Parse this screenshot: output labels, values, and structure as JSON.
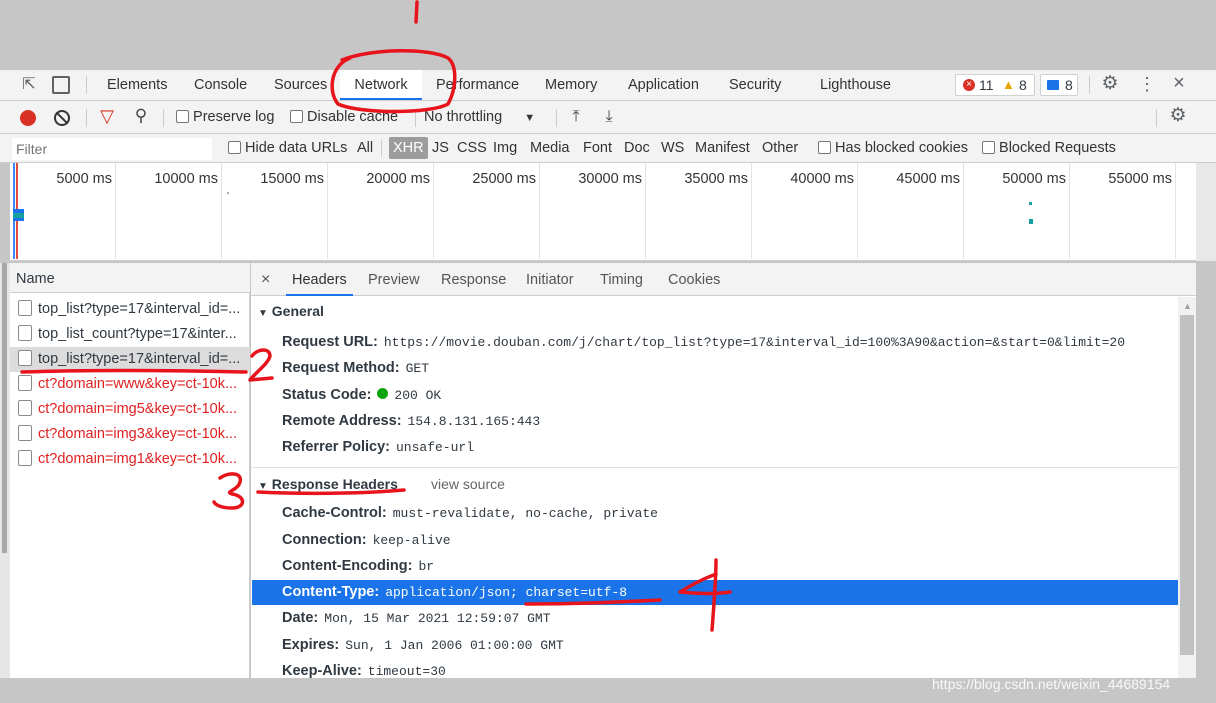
{
  "main_tabs": [
    "Elements",
    "Console",
    "Sources",
    "Network",
    "Performance",
    "Memory",
    "Application",
    "Security",
    "Lighthouse"
  ],
  "status": {
    "errors": "11",
    "warnings": "8",
    "messages": "8"
  },
  "toolbar": {
    "preserve_log": "Preserve log",
    "disable_cache": "Disable cache",
    "throttling": "No throttling"
  },
  "filter": {
    "placeholder": "Filter",
    "hide_data_urls": "Hide data URLs",
    "types": [
      "All",
      "XHR",
      "JS",
      "CSS",
      "Img",
      "Media",
      "Font",
      "Doc",
      "WS",
      "Manifest",
      "Other"
    ],
    "has_blocked_cookies": "Has blocked cookies",
    "blocked_requests": "Blocked Requests"
  },
  "timeline_ticks": [
    "5000 ms",
    "10000 ms",
    "15000 ms",
    "20000 ms",
    "25000 ms",
    "30000 ms",
    "35000 ms",
    "40000 ms",
    "45000 ms",
    "50000 ms",
    "55000 ms"
  ],
  "name_header": "Name",
  "requests": [
    {
      "name": "top_list?type=17&interval_id=...",
      "error": false
    },
    {
      "name": "top_list_count?type=17&inter...",
      "error": false
    },
    {
      "name": "top_list?type=17&interval_id=...",
      "error": false
    },
    {
      "name": "ct?domain=www&key=ct-10k...",
      "error": true
    },
    {
      "name": "ct?domain=img5&key=ct-10k...",
      "error": true
    },
    {
      "name": "ct?domain=img3&key=ct-10k...",
      "error": true
    },
    {
      "name": "ct?domain=img1&key=ct-10k...",
      "error": true
    }
  ],
  "detail_tabs": [
    "Headers",
    "Preview",
    "Response",
    "Initiator",
    "Timing",
    "Cookies"
  ],
  "general": {
    "title": "General",
    "rows": [
      {
        "key": "Request URL:",
        "value": "https://movie.douban.com/j/chart/top_list?type=17&interval_id=100%3A90&action=&start=0&limit=20"
      },
      {
        "key": "Request Method:",
        "value": "GET"
      },
      {
        "key": "Status Code:",
        "value": "200 OK"
      },
      {
        "key": "Remote Address:",
        "value": "154.8.131.165:443"
      },
      {
        "key": "Referrer Policy:",
        "value": "unsafe-url"
      }
    ]
  },
  "response_headers": {
    "title": "Response Headers",
    "view_source": "view source",
    "rows": [
      {
        "key": "Cache-Control:",
        "value": "must-revalidate, no-cache, private"
      },
      {
        "key": "Connection:",
        "value": "keep-alive"
      },
      {
        "key": "Content-Encoding:",
        "value": "br"
      },
      {
        "key": "Content-Type:",
        "value": "application/json; charset=utf-8"
      },
      {
        "key": "Date:",
        "value": "Mon, 15 Mar 2021 12:59:07 GMT"
      },
      {
        "key": "Expires:",
        "value": "Sun, 1 Jan 2006 01:00:00 GMT"
      },
      {
        "key": "Keep-Alive:",
        "value": "timeout=30"
      }
    ]
  },
  "watermark": "https://blog.csdn.net/weixin_44689154",
  "colors": {
    "accent": "#1a73e8",
    "record": "#d93025",
    "error": "#e02020",
    "annotation": "#e8141c",
    "selected_row": "#1a73e8"
  }
}
